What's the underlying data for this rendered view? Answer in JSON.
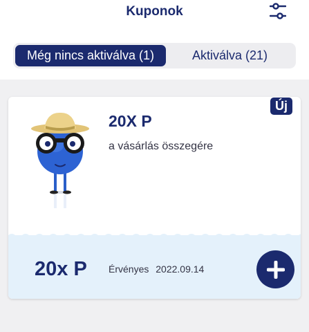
{
  "header": {
    "title": "Kuponok",
    "filter_icon": "sliders-icon"
  },
  "tabs": [
    {
      "label": "Még nincs aktiválva (1)",
      "active": true
    },
    {
      "label": "Aktiválva (21)",
      "active": false
    }
  ],
  "coupon": {
    "badge": "Új",
    "title": "20X P",
    "subtitle": "a vásárlás összegére",
    "points": "20x P",
    "valid_label": "Érvényes",
    "valid_date": "2022.09.14",
    "add_icon": "plus-icon"
  },
  "colors": {
    "brand": "#1b2a6e",
    "bottom_band": "#e4f1fb",
    "background": "#f0f0f2"
  }
}
